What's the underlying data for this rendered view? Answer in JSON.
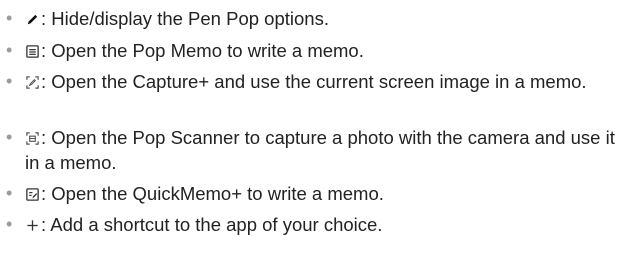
{
  "items": [
    {
      "icon": "pen-icon",
      "text": ": Hide/display the Pen Pop options."
    },
    {
      "icon": "memo-icon",
      "text": ": Open the Pop Memo to write a memo."
    },
    {
      "icon": "capture-icon",
      "text": ": Open the Capture+ and use the current screen image in a memo."
    },
    {
      "icon": "scanner-icon",
      "text": ": Open the Pop Scanner to capture a photo with the camera and use it in a memo."
    },
    {
      "icon": "quickmemo-icon",
      "text": ": Open the QuickMemo+ to write a memo."
    },
    {
      "icon": "plus-icon",
      "text": ": Add a shortcut to the app of your choice."
    }
  ],
  "bullet": "•"
}
